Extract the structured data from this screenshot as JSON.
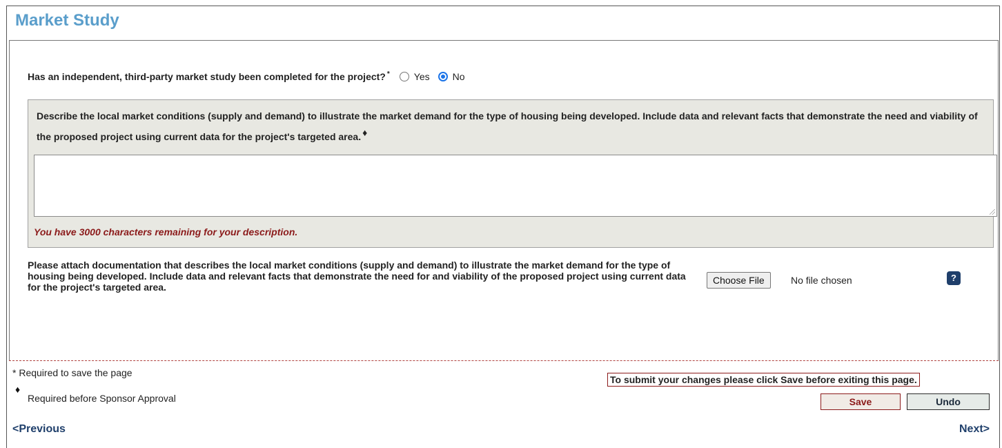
{
  "page": {
    "title": "Market Study"
  },
  "question": {
    "label": "Has an independent, third-party market study been completed for the project?",
    "required_marker": "*",
    "options": [
      {
        "label": "Yes",
        "selected": false
      },
      {
        "label": "No",
        "selected": true
      }
    ]
  },
  "description": {
    "label": "Describe the local market conditions (supply and demand) to illustrate the market demand for the type of housing being developed. Include data and relevant facts that demonstrate the need and viability of the proposed project using current data for the project's targeted area.",
    "marker": "♦",
    "value": "",
    "remaining_text": "You have 3000 characters remaining for your description."
  },
  "attachment": {
    "label": "Please attach documentation that describes the local market conditions (supply and demand) to illustrate the market demand for the type of housing being developed. Include data and relevant facts that demonstrate the need for and viability of the proposed project using current data for the project's targeted area.",
    "button_label": "Choose File",
    "status": "No file chosen",
    "help_label": "?"
  },
  "footer": {
    "required_save_note": "* Required to save the page",
    "approval_marker": "♦",
    "required_approval_note": "Required before Sponsor Approval",
    "submit_note": "To submit your changes please click Save before exiting this page.",
    "save_label": "Save",
    "undo_label": "Undo"
  },
  "nav": {
    "previous": "<Previous",
    "next": "Next>"
  },
  "colors": {
    "title": "#5a9ecb",
    "accent_red": "#8b1a1a",
    "nav": "#1f3f6b",
    "panel_bg": "#e8e8e2"
  }
}
